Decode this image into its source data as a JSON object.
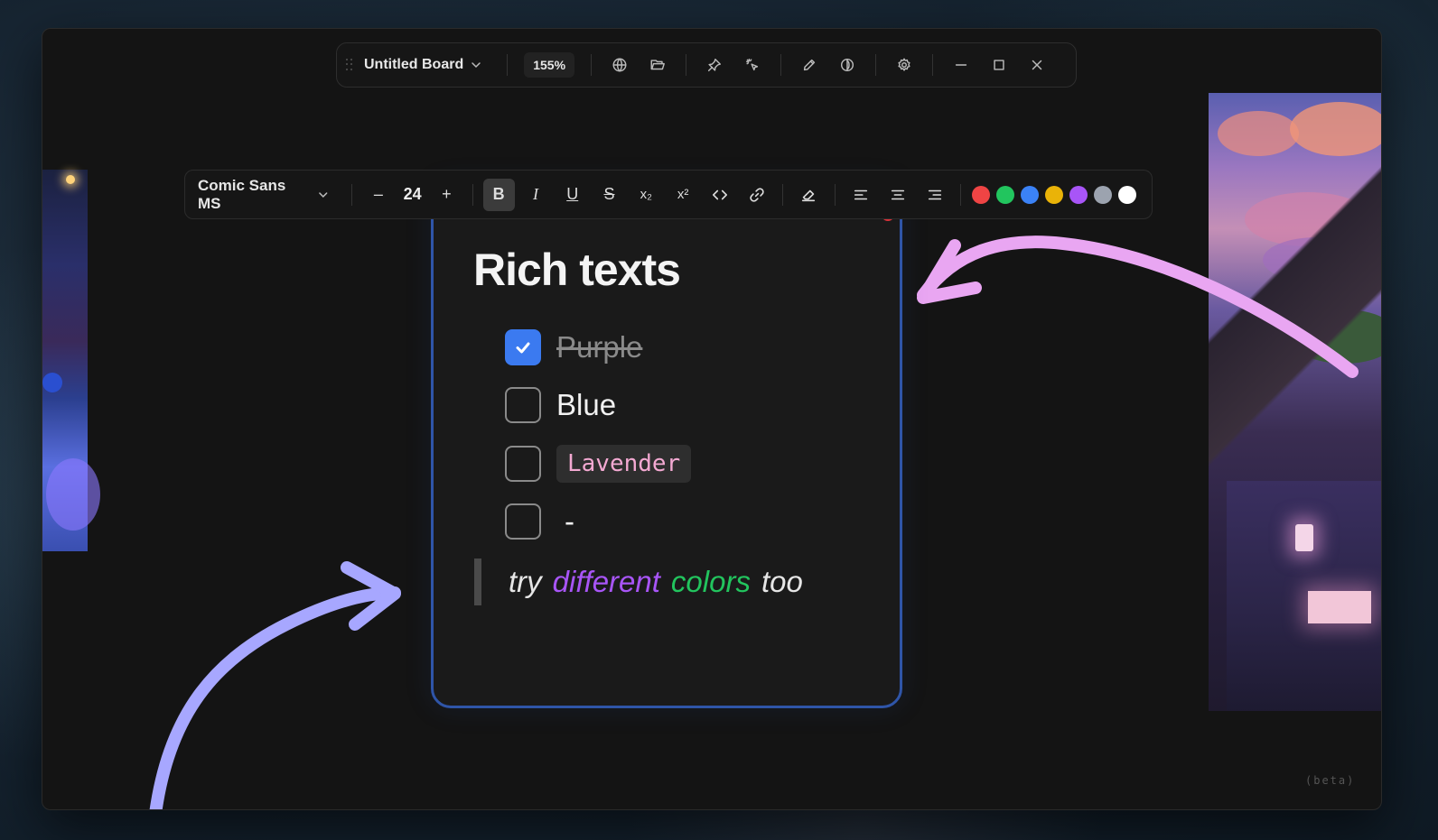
{
  "topbar": {
    "board_title": "Untitled Board",
    "zoom": "155%",
    "icons": [
      "grip-icon",
      "chevron-down-icon",
      "globe-icon",
      "folder-icon",
      "pin-icon",
      "laser-pointer-icon",
      "pencil-icon",
      "theme-icon",
      "gear-icon",
      "minimize-icon",
      "maximize-icon",
      "close-icon"
    ]
  },
  "format_toolbar": {
    "font_family": "Comic Sans MS",
    "font_size": "24",
    "decrease_label": "–",
    "increase_label": "+",
    "bold_label": "B",
    "italic_label": "I",
    "underline_label": "U",
    "strike_label": "S",
    "subscript_label": "x₂",
    "superscript_label": "x²",
    "colors": [
      "#ef4444",
      "#22c55e",
      "#3b82f6",
      "#eab308",
      "#a855f7",
      "#9ca3af",
      "#ffffff"
    ]
  },
  "card": {
    "title": "Rich texts",
    "todos": [
      {
        "label": "Purple",
        "checked": true,
        "style": "strikethrough"
      },
      {
        "label": "Blue",
        "checked": false,
        "style": "normal"
      },
      {
        "label": "Lavender",
        "checked": false,
        "style": "code"
      },
      {
        "label": "-",
        "checked": false,
        "style": "normal"
      }
    ],
    "quote": {
      "words": [
        {
          "text": "try",
          "color": "#e6e6e6"
        },
        {
          "text": "different",
          "color": "#a855f7"
        },
        {
          "text": "colors",
          "color": "#22c55e"
        },
        {
          "text": "too",
          "color": "#e6e6e6"
        }
      ]
    }
  },
  "footer": {
    "beta_label": "(beta)"
  },
  "arrows": {
    "pink_color": "#e9a6f2",
    "blue_color": "#a7a7ff"
  }
}
